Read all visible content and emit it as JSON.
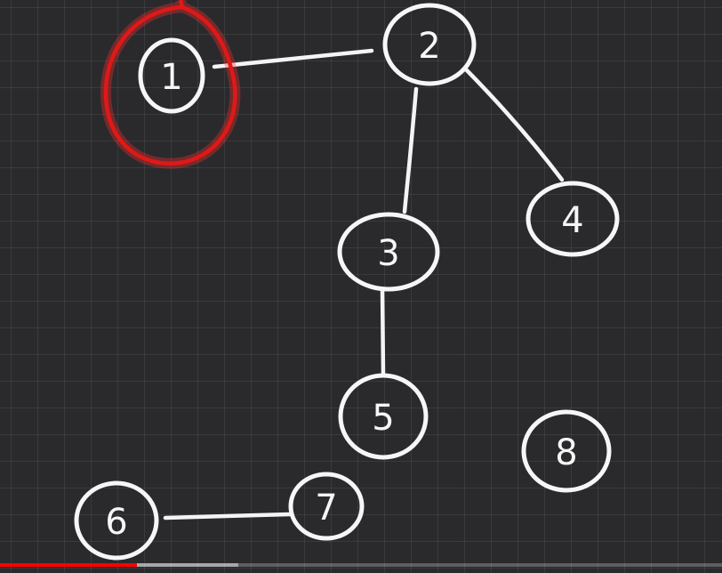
{
  "graph": {
    "nodes": [
      {
        "id": "1",
        "label": "1",
        "highlighted": true
      },
      {
        "id": "2",
        "label": "2"
      },
      {
        "id": "3",
        "label": "3"
      },
      {
        "id": "4",
        "label": "4"
      },
      {
        "id": "5",
        "label": "5"
      },
      {
        "id": "6",
        "label": "6"
      },
      {
        "id": "7",
        "label": "7"
      },
      {
        "id": "8",
        "label": "8"
      }
    ],
    "edges": [
      {
        "from": "1",
        "to": "2"
      },
      {
        "from": "2",
        "to": "3"
      },
      {
        "from": "2",
        "to": "4"
      },
      {
        "from": "3",
        "to": "5"
      },
      {
        "from": "6",
        "to": "7"
      }
    ]
  },
  "colors": {
    "background": "#2a2a2c",
    "ink": "#f6f6f6",
    "highlight": "#e01818",
    "progress": "#ff0000"
  },
  "video": {
    "progress_fraction": 0.19,
    "buffered_fraction": 0.33
  }
}
